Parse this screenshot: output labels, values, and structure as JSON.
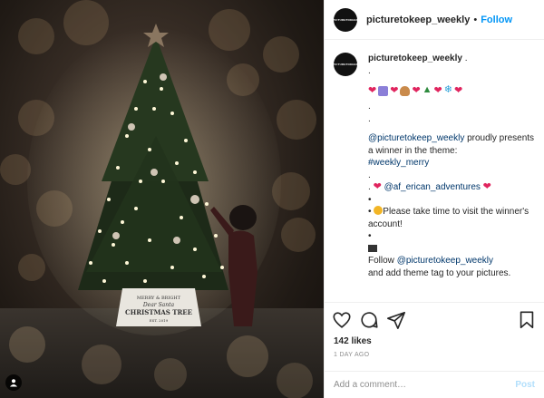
{
  "author": {
    "username": "picturetokeep_weekly",
    "avatar_text": "PICTURETOKEEP",
    "follow_label": "Follow",
    "separator": "•"
  },
  "caption": {
    "username": "picturetokeep_weekly",
    "after_username": " .",
    "dot": ".",
    "mention_user": "@picturetokeep_weekly",
    "proudly_text": " proudly presents a winner in the theme:",
    "hashtag": "#weekly_merry",
    "mention_winner": "@af_erican_adventures",
    "visit_text": "Please take time to visit the winner's account!",
    "follow_text": "Follow",
    "follow_mention": "@picturetokeep_weekly",
    "follow_tail": "and add theme tag to your pictures."
  },
  "tree_stand_text": [
    "MERRY & BRIGHT",
    "Dear Santa",
    "CHRISTMAS TREE",
    "EST. 2019"
  ],
  "likes": "142 likes",
  "time_ago": "1 DAY AGO",
  "comment_box": {
    "placeholder": "Add a comment…",
    "post_label": "Post"
  },
  "colors": {
    "accent": "#0095f6",
    "link": "#00376b",
    "heart": "#e0245e",
    "muted": "#8e8e8e"
  },
  "icons": [
    "heart-icon",
    "comment-icon",
    "share-icon",
    "save-icon",
    "user-tag-icon"
  ]
}
